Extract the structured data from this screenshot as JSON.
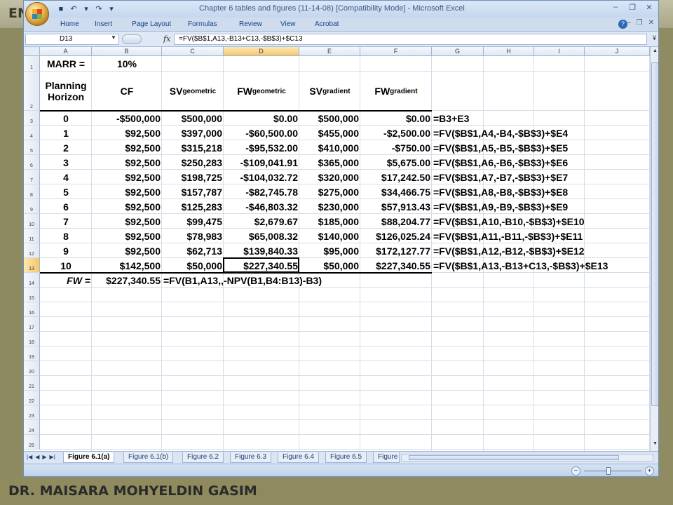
{
  "slide": {
    "top_title": "EN",
    "footer": "DR. MAISARA MOHYELDIN GASIM"
  },
  "window": {
    "title": "Chapter 6 tables and figures (11-14-08)  [Compatibility Mode]  -  Microsoft Excel"
  },
  "ribbon": {
    "tabs": [
      "Home",
      "Insert",
      "Page Layout",
      "Formulas",
      "Review",
      "View",
      "Acrobat"
    ]
  },
  "formula_bar": {
    "name_box": "D13",
    "fx": "fx",
    "formula": "=FV($B$1,A13,-B13+C13,-$B$3)+$C13"
  },
  "grid": {
    "columns": [
      "A",
      "B",
      "C",
      "D",
      "E",
      "F",
      "G",
      "H",
      "I",
      "J"
    ],
    "row_numbers": [
      "1",
      "2",
      "3",
      "4",
      "5",
      "6",
      "7",
      "8",
      "9",
      "10",
      "11",
      "12",
      "13",
      "14",
      "15",
      "16",
      "17",
      "18",
      "19",
      "20",
      "21",
      "22",
      "23",
      "24",
      "25"
    ],
    "row1": {
      "label": "MARR =",
      "value": "10%"
    },
    "headers": {
      "planning": "Planning Horizon",
      "cf": "CF",
      "sv_geo_main": "SV",
      "sv_geo_sub": "geometric",
      "fw_geo_main": "FW",
      "fw_geo_sub": "geometric",
      "sv_grad_main": "SV",
      "sv_grad_sub": "gradient",
      "fw_grad_main": "FW",
      "fw_grad_sub": "gradient"
    },
    "rows": [
      [
        "0",
        "-$500,000",
        "$500,000",
        "$0.00",
        "$500,000",
        "$0.00",
        "=B3+E3"
      ],
      [
        "1",
        "$92,500",
        "$397,000",
        "-$60,500.00",
        "$455,000",
        "-$2,500.00",
        "=FV($B$1,A4,-B4,-$B$3)+$E4"
      ],
      [
        "2",
        "$92,500",
        "$315,218",
        "-$95,532.00",
        "$410,000",
        "-$750.00",
        "=FV($B$1,A5,-B5,-$B$3)+$E5"
      ],
      [
        "3",
        "$92,500",
        "$250,283",
        "-$109,041.91",
        "$365,000",
        "$5,675.00",
        "=FV($B$1,A6,-B6,-$B$3)+$E6"
      ],
      [
        "4",
        "$92,500",
        "$198,725",
        "-$104,032.72",
        "$320,000",
        "$17,242.50",
        "=FV($B$1,A7,-B7,-$B$3)+$E7"
      ],
      [
        "5",
        "$92,500",
        "$157,787",
        "-$82,745.78",
        "$275,000",
        "$34,466.75",
        "=FV($B$1,A8,-B8,-$B$3)+$E8"
      ],
      [
        "6",
        "$92,500",
        "$125,283",
        "-$46,803.32",
        "$230,000",
        "$57,913.43",
        "=FV($B$1,A9,-B9,-$B$3)+$E9"
      ],
      [
        "7",
        "$92,500",
        "$99,475",
        "$2,679.67",
        "$185,000",
        "$88,204.77",
        "=FV($B$1,A10,-B10,-$B$3)+$E10"
      ],
      [
        "8",
        "$92,500",
        "$78,983",
        "$65,008.32",
        "$140,000",
        "$126,025.24",
        "=FV($B$1,A11,-B11,-$B$3)+$E11"
      ],
      [
        "9",
        "$92,500",
        "$62,713",
        "$139,840.33",
        "$95,000",
        "$172,127.77",
        "=FV($B$1,A12,-B12,-$B$3)+$E12"
      ],
      [
        "10",
        "$142,500",
        "$50,000",
        "$227,340.55",
        "$50,000",
        "$227,340.55",
        "=FV($B$1,A13,-B13+C13,-$B$3)+$E13"
      ]
    ],
    "row14": {
      "label": "FW =",
      "value": "$227,340.55",
      "formula": "=FV(B1,A13,,-NPV(B1,B4:B13)-B3)"
    }
  },
  "sheets": [
    "Figure 6.1(a)",
    "Figure 6.1(b)",
    "Figure 6.2",
    "Figure 6.3",
    "Figure 6.4",
    "Figure 6.5",
    "Figure"
  ]
}
